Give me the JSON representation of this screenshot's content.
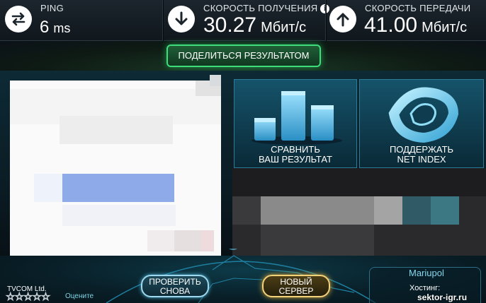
{
  "stats": {
    "ping": {
      "label": "PING",
      "value": "6",
      "unit": "ms"
    },
    "download": {
      "label": "СКОРОСТЬ ПОЛУЧЕНИЯ",
      "value": "30.27",
      "unit": "Мбит/с",
      "icon": "down-arrow-icon"
    },
    "upload": {
      "label": "СКОРОСТЬ ПЕРЕДАЧИ",
      "value": "41.00",
      "unit": "Мбит/с",
      "icon": "up-arrow-icon"
    }
  },
  "share_button": "ПОДЕЛИТЬСЯ РЕЗУЛЬТАТОМ",
  "panels": {
    "compare": {
      "line1": "СРАВНИТЬ",
      "line2": "ВАШ РЕЗУЛЬТАТ"
    },
    "support": {
      "line1": "ПОДДЕРЖАТЬ",
      "line2": "NET INDEX"
    }
  },
  "bottom": {
    "isp_name": "TVCOM Ltd.",
    "stars": "☆☆☆☆☆",
    "rate_label": "Оцените",
    "test_again": {
      "line1": "ПРОВЕРИТЬ",
      "line2": "СНОВА"
    },
    "new_server": {
      "line1": "НОВЫЙ",
      "line2": "СЕРВЕР"
    },
    "server_city": "Mariupol",
    "host_label": "Хостинг:"
  },
  "watermark": "sektor-igr.ru",
  "colors": {
    "accent_green": "#3fdc7a",
    "accent_blue": "#4fb7d8",
    "accent_gold": "#f3d27a",
    "panel": "#15536a"
  }
}
